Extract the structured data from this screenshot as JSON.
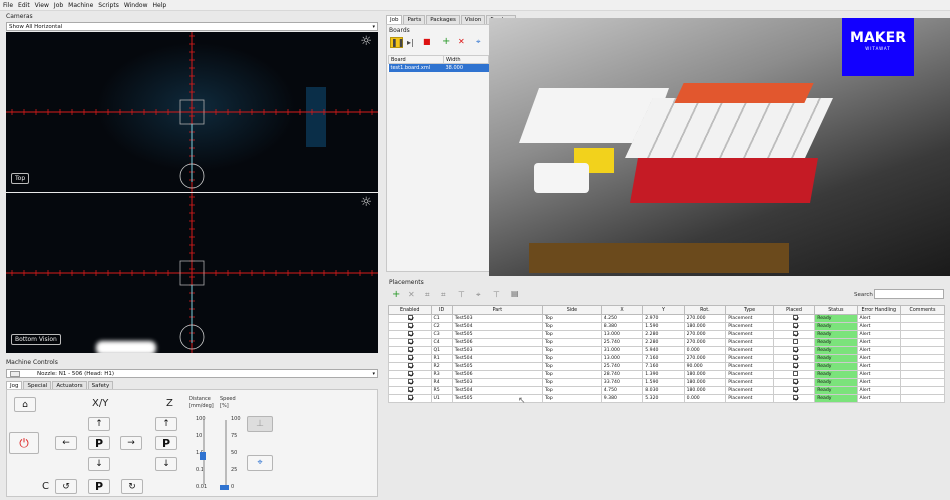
{
  "menu": [
    "File",
    "Edit",
    "View",
    "Job",
    "Machine",
    "Scripts",
    "Window",
    "Help"
  ],
  "cameras": {
    "title": "Cameras",
    "view_select": "Show All Horizontal",
    "top_label": "Top",
    "bottom_label": "Bottom Vision"
  },
  "machine_controls": {
    "title": "Machine Controls",
    "nozzle_select": "Nozzle: N1 - 506 (Head: H1)",
    "tabs": [
      "Jog",
      "Special",
      "Actuators",
      "Safety"
    ],
    "xy_label": "X/Y",
    "z_label": "Z",
    "c_label": "C",
    "park_label": "P",
    "distance_label": "Distance",
    "distance_unit": "[mm/deg]",
    "speed_label": "Speed",
    "speed_unit": "[%]",
    "distance_ticks": [
      "100",
      "10",
      "1.0",
      "0.1",
      "0.01"
    ],
    "speed_ticks": [
      "100",
      "75",
      "50",
      "25",
      "0"
    ],
    "distance_value": 1.0,
    "speed_value": 0
  },
  "job_tabs": [
    "Job",
    "Parts",
    "Packages",
    "Vision",
    "Feeders"
  ],
  "boards": {
    "title": "Boards",
    "columns": [
      "Board",
      "Width"
    ],
    "rows": [
      [
        "test1.board.xml",
        "38.000"
      ]
    ]
  },
  "overlay": {
    "brand_top": "MAKER",
    "brand_bottom": "WITAWAT"
  },
  "placements": {
    "title": "Placements",
    "search_label": "Search",
    "columns": [
      "Enabled",
      "ID",
      "Part",
      "Side",
      "X",
      "Y",
      "Rot.",
      "Type",
      "Placed",
      "Status",
      "Error Handling",
      "Comments"
    ],
    "rows": [
      {
        "enabled": true,
        "id": "C1",
        "part": "Test503",
        "side": "Top",
        "x": "4.250",
        "y": "2.970",
        "rot": "270.000",
        "type": "Placement",
        "placed": true,
        "status": "Ready",
        "error": "Alert",
        "comments": ""
      },
      {
        "enabled": true,
        "id": "C2",
        "part": "Test504",
        "side": "Top",
        "x": "8.380",
        "y": "1.590",
        "rot": "180.000",
        "type": "Placement",
        "placed": true,
        "status": "Ready",
        "error": "Alert",
        "comments": ""
      },
      {
        "enabled": true,
        "id": "C3",
        "part": "Test505",
        "side": "Top",
        "x": "13.000",
        "y": "2.280",
        "rot": "270.000",
        "type": "Placement",
        "placed": true,
        "status": "Ready",
        "error": "Alert",
        "comments": ""
      },
      {
        "enabled": true,
        "id": "C4",
        "part": "Test506",
        "side": "Top",
        "x": "25.740",
        "y": "2.280",
        "rot": "270.000",
        "type": "Placement",
        "placed": false,
        "status": "Ready",
        "error": "Alert",
        "comments": ""
      },
      {
        "enabled": true,
        "id": "Q1",
        "part": "Test503",
        "side": "Top",
        "x": "31.000",
        "y": "5.940",
        "rot": "0.000",
        "type": "Placement",
        "placed": true,
        "status": "Ready",
        "error": "Alert",
        "comments": ""
      },
      {
        "enabled": true,
        "id": "R1",
        "part": "Test504",
        "side": "Top",
        "x": "13.000",
        "y": "7.160",
        "rot": "270.000",
        "type": "Placement",
        "placed": true,
        "status": "Ready",
        "error": "Alert",
        "comments": ""
      },
      {
        "enabled": true,
        "id": "R2",
        "part": "Test505",
        "side": "Top",
        "x": "25.740",
        "y": "7.160",
        "rot": "90.000",
        "type": "Placement",
        "placed": true,
        "status": "Ready",
        "error": "Alert",
        "comments": ""
      },
      {
        "enabled": true,
        "id": "R3",
        "part": "Test506",
        "side": "Top",
        "x": "28.740",
        "y": "1.390",
        "rot": "180.000",
        "type": "Placement",
        "placed": false,
        "status": "Ready",
        "error": "Alert",
        "comments": ""
      },
      {
        "enabled": true,
        "id": "R4",
        "part": "Test503",
        "side": "Top",
        "x": "33.740",
        "y": "1.590",
        "rot": "180.000",
        "type": "Placement",
        "placed": true,
        "status": "Ready",
        "error": "Alert",
        "comments": ""
      },
      {
        "enabled": true,
        "id": "R5",
        "part": "Test504",
        "side": "Top",
        "x": "4.750",
        "y": "8.030",
        "rot": "180.000",
        "type": "Placement",
        "placed": true,
        "status": "Ready",
        "error": "Alert",
        "comments": ""
      },
      {
        "enabled": true,
        "id": "U1",
        "part": "Test505",
        "side": "Top",
        "x": "9.380",
        "y": "5.320",
        "rot": "0.000",
        "type": "Placement",
        "placed": true,
        "status": "Ready",
        "error": "Alert",
        "comments": ""
      }
    ]
  },
  "colors": {
    "ready": "#7be37b",
    "selection": "#2f73d0",
    "reticle": "#d61b1b",
    "reticle_center": "#7fd0e0",
    "brand_bg": "#1200ff"
  }
}
